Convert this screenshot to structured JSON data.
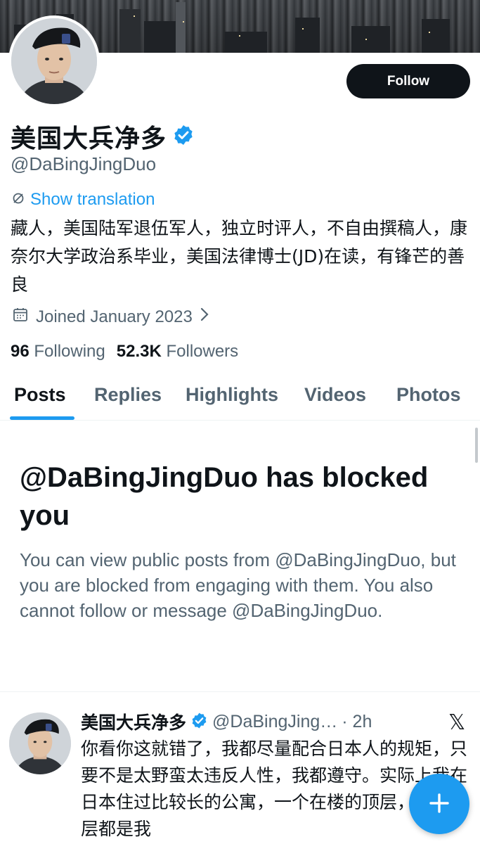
{
  "profile": {
    "display_name": "美国大兵净多",
    "handle": "@DaBingJingDuo",
    "verified": true,
    "follow_label": "Follow",
    "show_translation": "Show translation",
    "bio": "藏人，美国陆军退伍军人，独立时评人，不自由撰稿人，康奈尔大学政治系毕业，美国法律博士(JD)在读，有锋芒的善良",
    "joined": "Joined January 2023",
    "following_count": "96",
    "following_label": "Following",
    "followers_count": "52.3K",
    "followers_label": "Followers"
  },
  "tabs": [
    {
      "label": "Posts",
      "active": true
    },
    {
      "label": "Replies",
      "active": false
    },
    {
      "label": "Highlights",
      "active": false
    },
    {
      "label": "Videos",
      "active": false
    },
    {
      "label": "Photos",
      "active": false
    }
  ],
  "blocked": {
    "title": "@DaBingJingDuo has blocked you",
    "description": "You can view public posts from @DaBingJingDuo, but you are blocked from engaging with them. You also cannot follow or message @DaBingJingDuo."
  },
  "tweet": {
    "name": "美国大兵净多",
    "handle": "@DaBingJing…",
    "time": "· 2h",
    "text": "你看你这就错了，我都尽量配合日本人的规矩，只要不是太野蛮太违反人性，我都遵守。实际上我在日本住过比较长的公寓，一个在楼的顶层，且整个层都是我"
  },
  "colors": {
    "accent": "#1d9bf0",
    "text_primary": "#0f1419",
    "text_secondary": "#536471"
  },
  "icons": {
    "verified": "verified-badge-icon",
    "translate": "translate-icon",
    "calendar": "calendar-icon",
    "chevron": "chevron-right-icon",
    "source": "x-logo-icon",
    "compose": "plus-icon"
  }
}
